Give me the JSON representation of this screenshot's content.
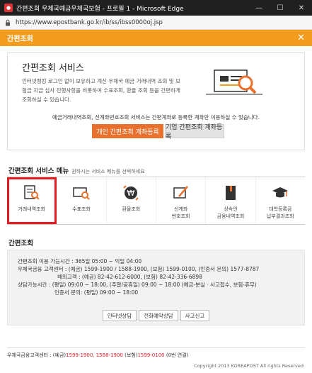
{
  "window": {
    "title": "간편조회 우체국예금우체국보험 - 프로필 1 - Microsoft Edge",
    "minimize": "—",
    "maximize": "☐",
    "close": "✕"
  },
  "address": {
    "url": "https://www.epostbank.go.kr/ib/ss/ibss0000oj.jsp"
  },
  "header": {
    "title": "간편조회",
    "close": "✕"
  },
  "intro": {
    "title": "간편조회 서비스",
    "desc": "인터넷뱅킹 로그인 없이 보유하고 계신 우체국 예금 거래내역 조회 및 보험금 지급 심사 진행사항을 비롯하여 수표조회, 환율 조회 등을 간편하게 조회하실 수 있습니다.",
    "notice": "예금거래내역조회, 신계좌번호조회 서비스는 간편계좌로 등록한 계좌만 이용하실 수 있습니다.",
    "btn_personal": "개인 간편조회 계좌등록",
    "btn_corp": "기업 간편조회 계좌등록"
  },
  "menu": {
    "title": "간편조회 서비스 메뉴",
    "subtitle": "원하시는 서비스 메뉴를 선택하세요",
    "items": [
      {
        "label": "거래내역조회"
      },
      {
        "label": "수표조회"
      },
      {
        "label": "환율조회"
      },
      {
        "label": "신계좌\n번호조회"
      },
      {
        "label": "상속인\n금융내역조회"
      },
      {
        "label": "대학등록금\n납부결과조회"
      }
    ]
  },
  "info": {
    "title": "간편조회",
    "lines": [
      "간편조회 이용 가능시간 : 365일 05:00 ~ 익일 04:00",
      "우체국금융 고객센터 : (예금) 1599-1900 / 1588-1900, (보험) 1599-0100, (인증서 문의) 1577-8787",
      "해외고객 : (예금) 82-42-612-6000, (보험) 82-42-336-6898",
      "상담가능시간 : (평일) 09:00 ~ 18:00, (주말/공휴일) 09:00 ~ 18:00 (예금-분실 · 사고접수, 보험-휴무)",
      "인증서 문의: (평일) 09:00 ~ 18:00"
    ],
    "buttons": [
      "인터넷상담",
      "전화예약상담",
      "사고신고"
    ]
  },
  "footer": {
    "prefix": "우체국금융고객센터 : (예금)",
    "phones_deposit": "1599-1900, 1588-1900",
    "mid": "(보험)",
    "phone_insurance": "1599-0100",
    "suffix": "(0번 연결)",
    "copyright": "Copyright 2013 KOREAPOST All rights Reserved"
  },
  "colors": {
    "accent": "#f39c1e",
    "button": "#e8712d",
    "highlight": "#e31b23"
  }
}
